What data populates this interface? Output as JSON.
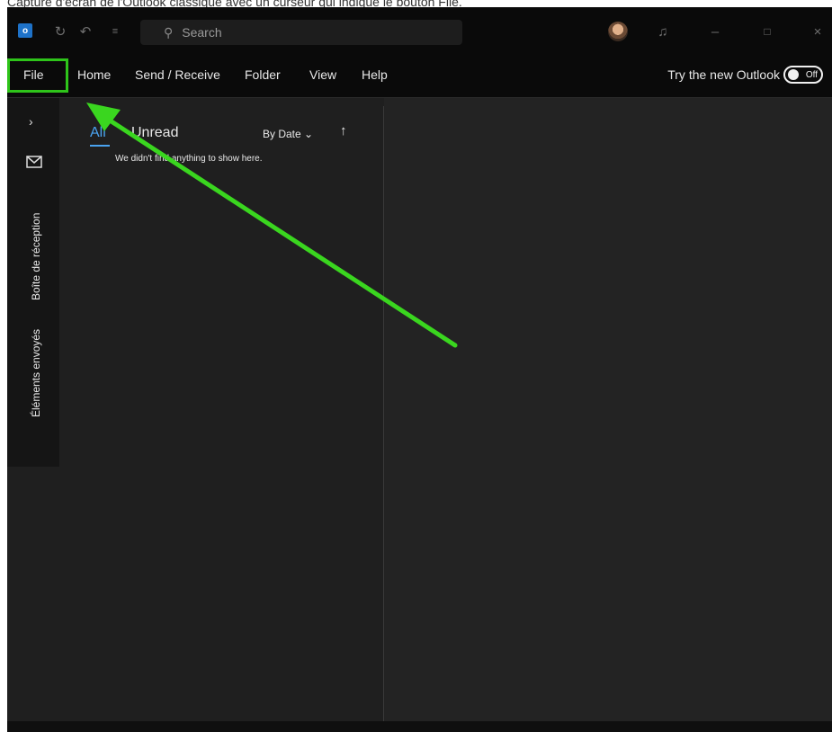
{
  "caption": "Capture d'écran de l'Outlook classique avec un curseur qui indique le bouton File.",
  "titlebar": {
    "search_placeholder": "Search",
    "icons": [
      "outlook-logo",
      "sync-icon",
      "undo-icon",
      "customize-icon",
      "search-icon",
      "bell-icon",
      "minimize-icon",
      "maximize-icon",
      "close-icon"
    ]
  },
  "menu": {
    "items": [
      "File",
      "Home",
      "Send / Receive",
      "Folder",
      "View",
      "Help"
    ],
    "try_new": "Try the new Outlook",
    "toggle_label": "Off"
  },
  "leftnav": {
    "folders": [
      "Boîte de réception",
      "Éléments envoyés"
    ]
  },
  "list": {
    "tabs": [
      "All",
      "Unread"
    ],
    "sort": "By Date",
    "empty_message": "We didn't find anything to show here."
  },
  "colors": {
    "highlight": "#2ec41a",
    "accent": "#4aa3f0",
    "background": "#1f1f1f"
  }
}
